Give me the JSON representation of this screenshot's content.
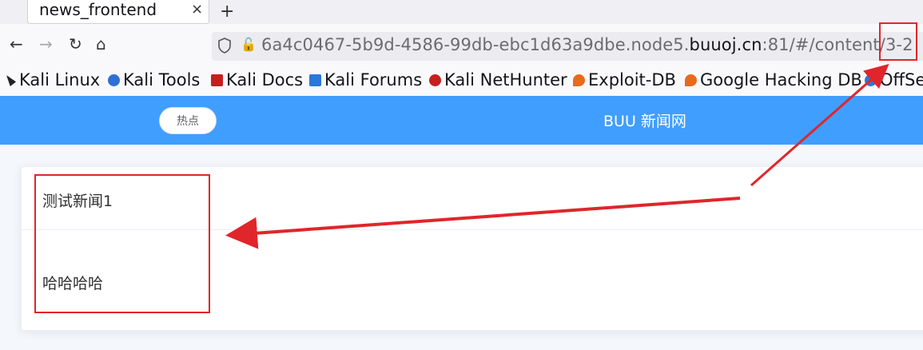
{
  "browser": {
    "tab": {
      "title": "news_frontend",
      "close": "×"
    },
    "new_tab": "+",
    "nav": {
      "back": "←",
      "forward": "→",
      "reload": "↻",
      "home": "⌂"
    },
    "url": {
      "prefix": "6a4c0467-5b9d-4586-99db-ebc1d63a9dbe.node5.",
      "host": "buuoj.cn",
      "suffix": ":81/#/content/",
      "highlight": "3-2"
    },
    "bookmarks": [
      {
        "label": "Kali Linux",
        "icon": "kali-icon",
        "color": "#222222"
      },
      {
        "label": "Kali Tools",
        "icon": "kali-tools-icon",
        "color": "#2f6fd6"
      },
      {
        "label": "Kali Docs",
        "icon": "kali-docs-icon",
        "color": "#c81e1e"
      },
      {
        "label": "Kali Forums",
        "icon": "kali-forums-icon",
        "color": "#2a78d8"
      },
      {
        "label": "Kali NetHunter",
        "icon": "nethunter-icon",
        "color": "#c81e1e"
      },
      {
        "label": "Exploit-DB",
        "icon": "exploit-db-icon",
        "color": "#e86a1d"
      },
      {
        "label": "Google Hacking DB",
        "icon": "ghdb-icon",
        "color": "#e86a1d"
      },
      {
        "label": "OffSe",
        "icon": "offsec-icon",
        "color": "#2a78d8"
      }
    ]
  },
  "app": {
    "hot_button": "热点",
    "site_title": "BUU 新闻网",
    "accent_color": "#409eff",
    "news": {
      "title": "测试新闻1",
      "body": "哈哈哈哈"
    }
  },
  "annotations": {
    "color": "#e0262a"
  }
}
